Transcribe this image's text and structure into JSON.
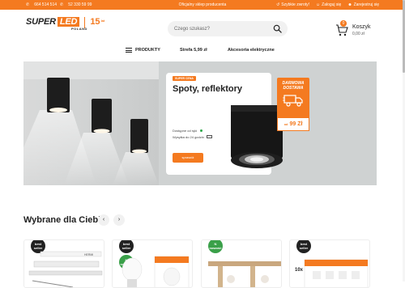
{
  "topbar": {
    "phone1": "664 514 514",
    "phone2": "52 330 59 99",
    "center_text": "Oficjalny sklep producenta",
    "quick_returns": "Szybkie zwroty!",
    "login": "Zaloguj się",
    "register": "Zarejestruj się"
  },
  "logo": {
    "super": "SUPER",
    "led": "LED",
    "country": "POLAND",
    "years": "15",
    "years_suffix": "lat"
  },
  "search": {
    "placeholder": "Czego szukasz?"
  },
  "cart": {
    "label": "Koszyk",
    "total": "0,00 zł",
    "count": "0"
  },
  "nav": {
    "products": "PRODUKTY",
    "zone": "Strefa 5,99 zł",
    "accessories": "Akcesoria elektryczne"
  },
  "hero": {
    "tag": "SUPER CENA",
    "title": "Spoty, reflektory",
    "availability_label": "Dostępne od ręki",
    "shipping_label": "Wysyłka do 24 godzin",
    "button": "sprawdź",
    "delivery_line1": "DARMOWA",
    "delivery_line2": "DOSTAWA",
    "price_prefix": "od",
    "price": "99 Zł"
  },
  "recommended": {
    "title": "Wybrane dla Ciebie",
    "prev": "‹",
    "next": "›",
    "products": [
      {
        "badge": "best seller",
        "brand": "HERMI"
      },
      {
        "badge": "best seller",
        "badge2": "N nowość"
      },
      {
        "badge": "N nowość"
      },
      {
        "badge": "best seller",
        "pack": "10x"
      }
    ]
  },
  "colors": {
    "accent": "#f47a20",
    "dark": "#222222",
    "green": "#3aa049"
  }
}
